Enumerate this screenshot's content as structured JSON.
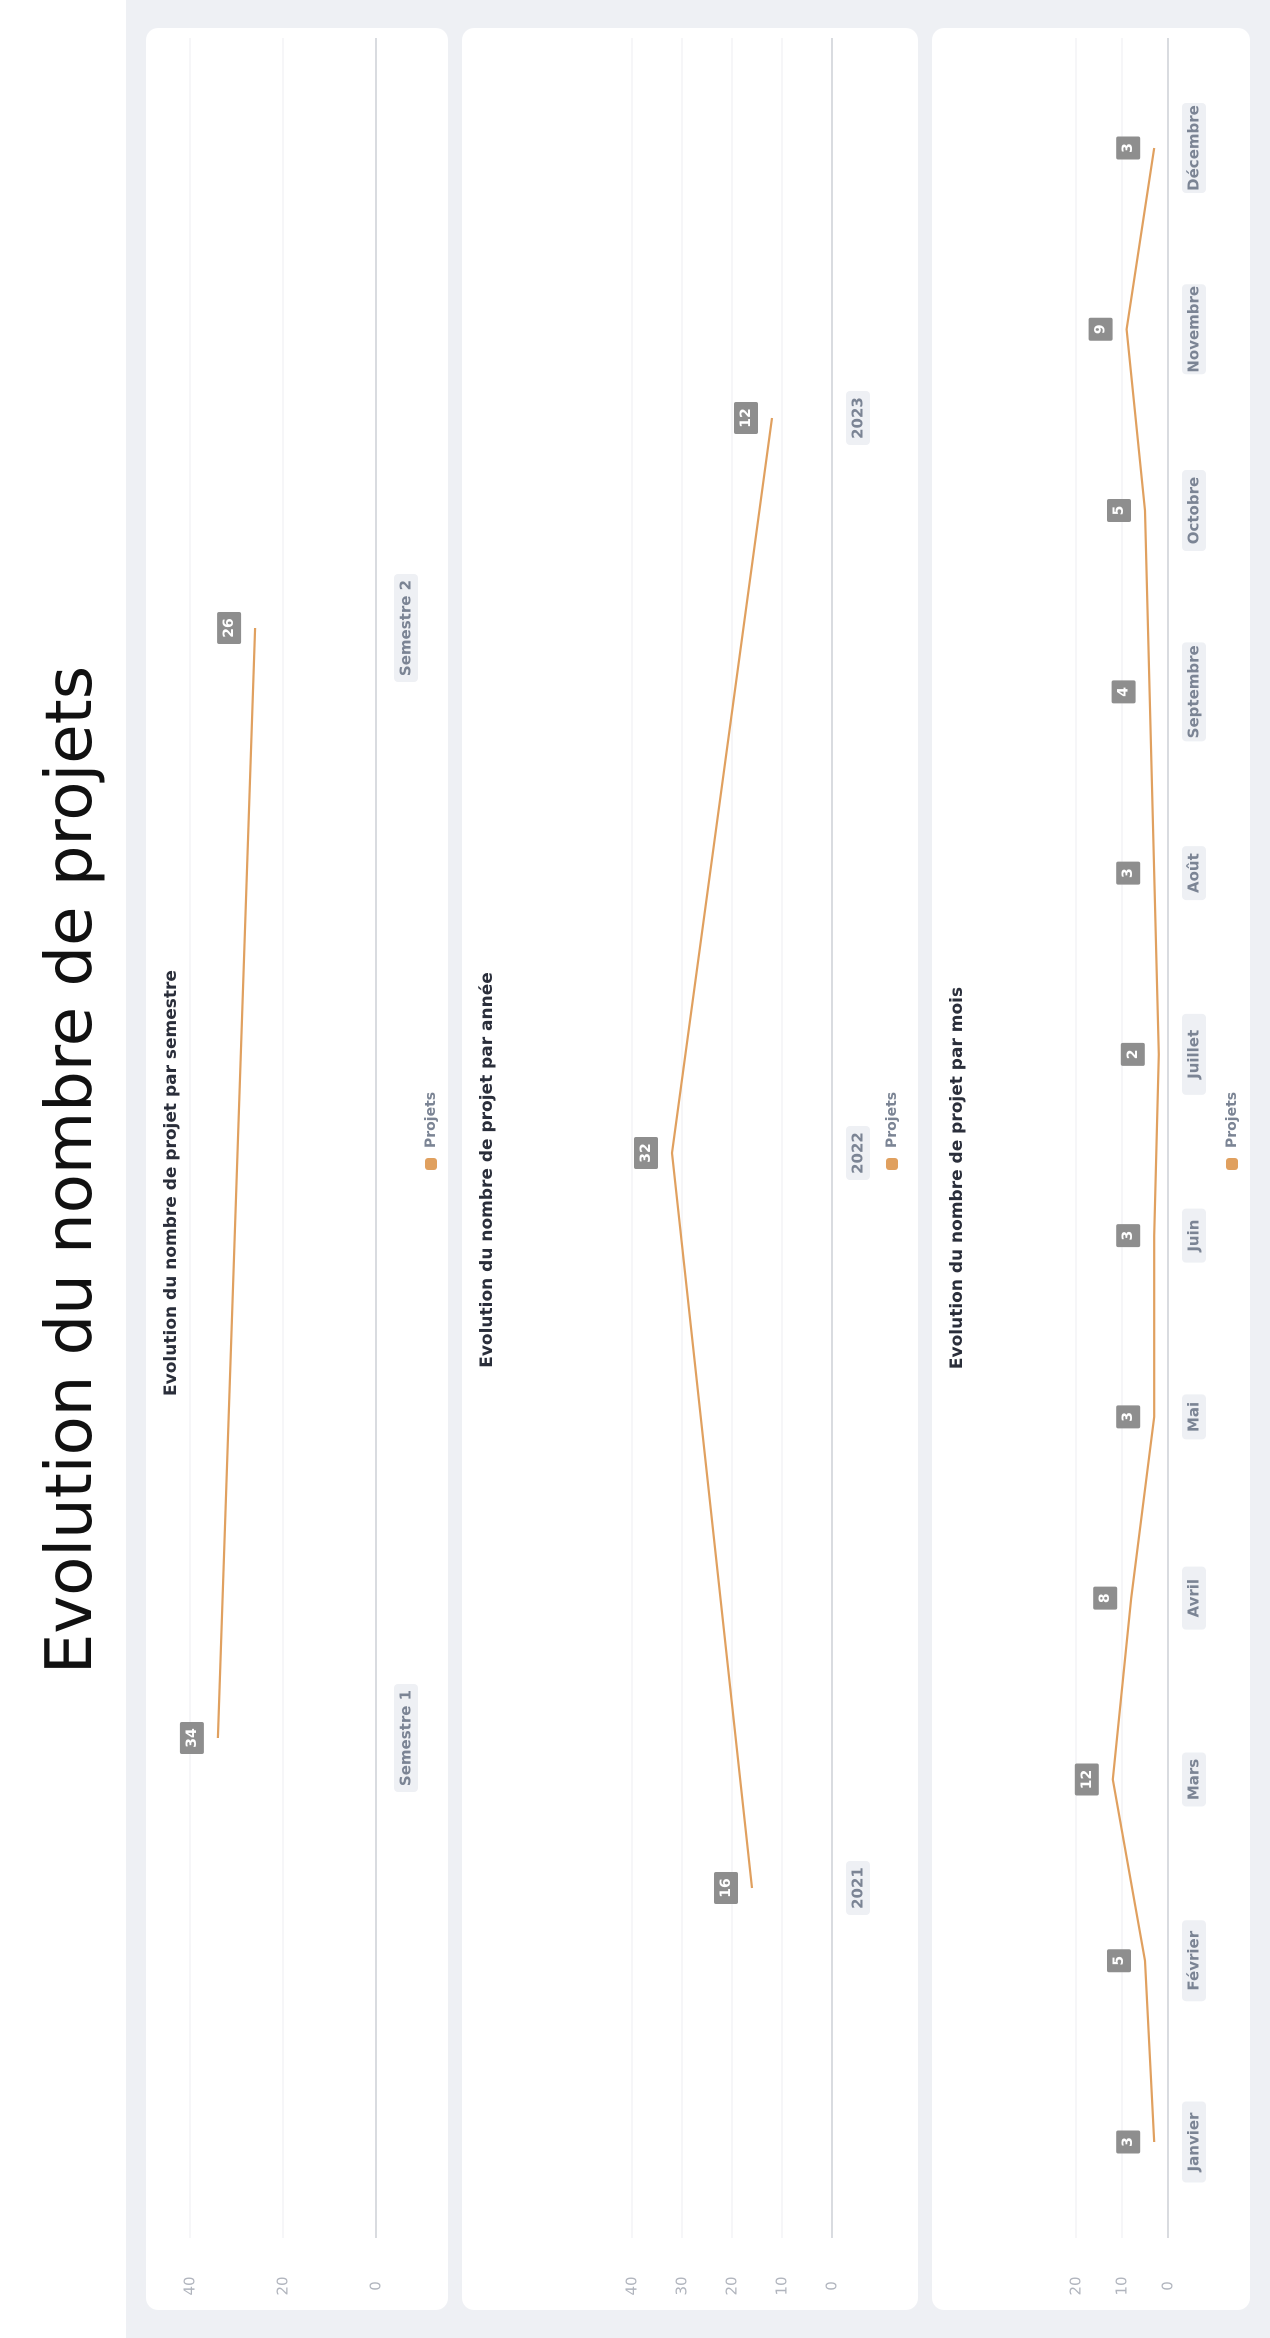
{
  "page_title": "Evolution du nombre de projets",
  "colors": {
    "series": "#e0a05f",
    "card": "#ffffff",
    "background": "#eef0f4",
    "value_label_bg": "#8e8e8e",
    "category_label_bg": "#eef0f4"
  },
  "chart_data": [
    {
      "type": "line",
      "title": "Evolution du nombre de projet par semestre",
      "categories": [
        "Semestre 1",
        "Semestre 2"
      ],
      "series": [
        {
          "name": "Projets",
          "values": [
            34,
            26
          ]
        }
      ],
      "ylim": [
        0,
        40
      ],
      "yticks": [
        0,
        20,
        40
      ],
      "grid": true,
      "legend": "bottom"
    },
    {
      "type": "line",
      "title": "Evolution du nombre de projet par année",
      "categories": [
        "2021",
        "2022",
        "2023"
      ],
      "series": [
        {
          "name": "Projets",
          "values": [
            16,
            32,
            12
          ]
        }
      ],
      "ylim": [
        0,
        40
      ],
      "yticks": [
        0,
        10,
        20,
        30,
        40
      ],
      "grid": true,
      "legend": "bottom"
    },
    {
      "type": "line",
      "title": "Evolution du nombre de projet par mois",
      "categories": [
        "Janvier",
        "Février",
        "Mars",
        "Avril",
        "Mai",
        "Juin",
        "Juillet",
        "Août",
        "Septembre",
        "Octobre",
        "Novembre",
        "Décembre"
      ],
      "series": [
        {
          "name": "Projets",
          "values": [
            3,
            5,
            12,
            8,
            3,
            3,
            2,
            3,
            4,
            5,
            9,
            3
          ]
        }
      ],
      "ylim": [
        0,
        20
      ],
      "yticks": [
        0,
        10,
        20
      ],
      "grid": true,
      "legend": "bottom"
    }
  ]
}
